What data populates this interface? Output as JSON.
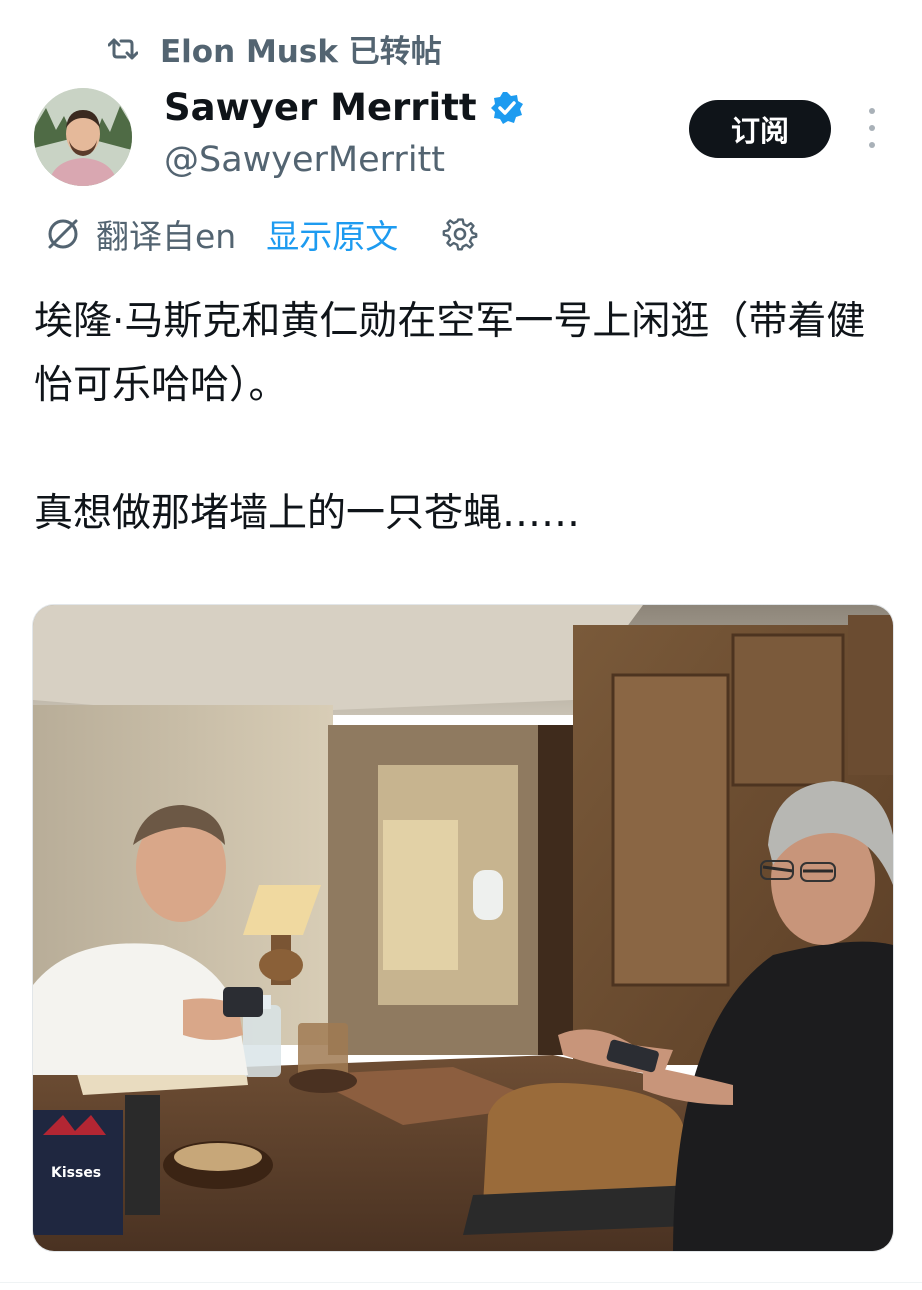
{
  "repost": {
    "label": "Elon Musk 已转帖",
    "icon": "repost-icon"
  },
  "author": {
    "display_name": "Sawyer Merritt",
    "handle": "@SawyerMerritt",
    "verified": true,
    "avatar_icon": "avatar"
  },
  "actions": {
    "subscribe_label": "订阅",
    "more_icon": "more-icon"
  },
  "translation": {
    "translated_from": "翻译自en",
    "show_original": "显示原文",
    "icon": "translate-icon",
    "settings_icon": "gear-icon"
  },
  "tweet": {
    "text": "埃隆·马斯克和黄仁勋在空军一号上闲逛（带着健怡可乐哈哈）。\n\n真想做那堵墙上的一只苍蝇……"
  },
  "media": {
    "alt_icon": "photo",
    "box_label": "Kisses"
  },
  "colors": {
    "accent": "#1d9bf0",
    "text_primary": "#0f1419",
    "text_secondary": "#536471",
    "button_bg": "#0f1419"
  }
}
